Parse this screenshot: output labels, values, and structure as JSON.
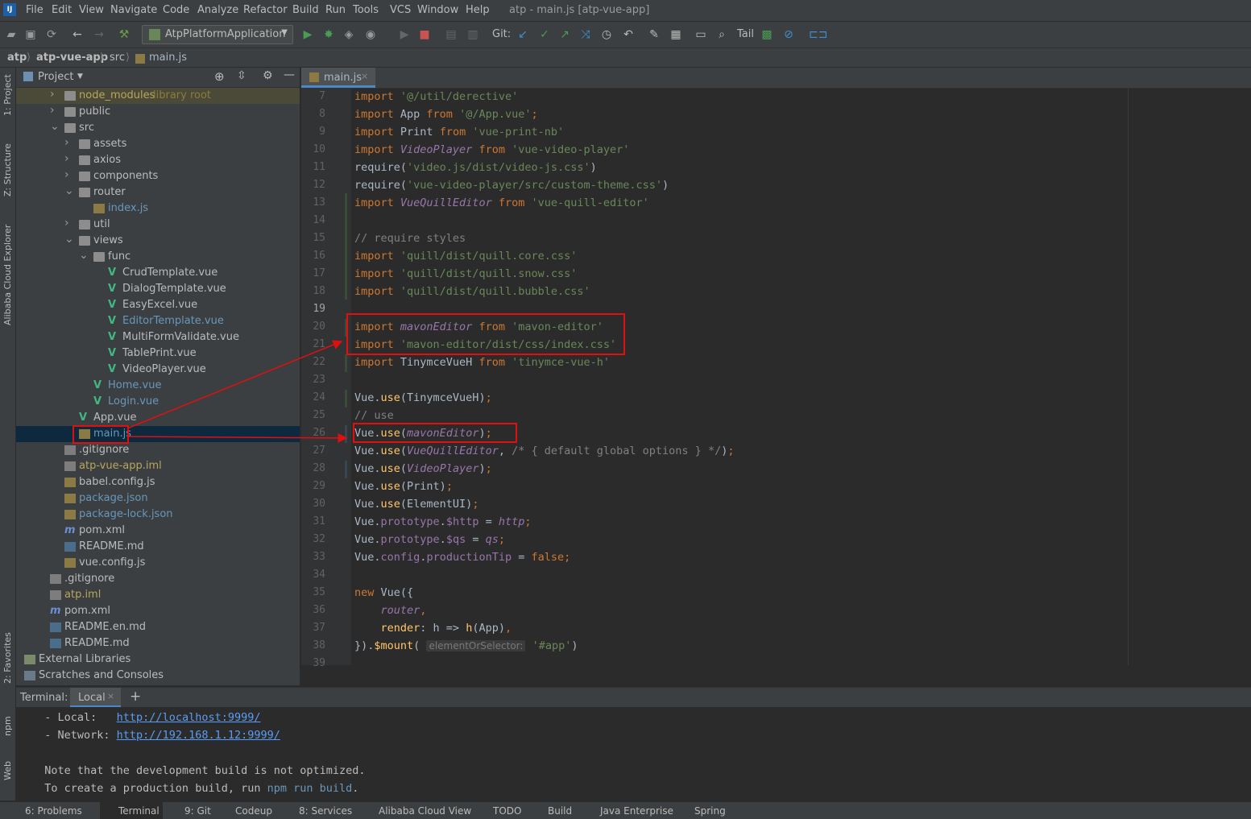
{
  "window_title": "atp - main.js [atp-vue-app]",
  "menu": [
    "File",
    "Edit",
    "View",
    "Navigate",
    "Code",
    "Analyze",
    "Refactor",
    "Build",
    "Run",
    "Tools",
    "VCS",
    "Window",
    "Help"
  ],
  "toolbar": {
    "run_config": "AtpPlatformApplication",
    "git_label": "Git:",
    "tail_label": "Tail"
  },
  "breadcrumb": [
    "atp",
    "atp-vue-app",
    "src",
    "main.js"
  ],
  "left_strip": [
    "1: Project",
    "Z: Structure",
    "Alibaba Cloud Explorer",
    "2: Favorites",
    "npm",
    "Web"
  ],
  "project": {
    "title": "Project",
    "tree": [
      {
        "label": "node_modules",
        "suffix": "library root",
        "icon": "folder",
        "arrow": "right",
        "indent": 1
      },
      {
        "label": "public",
        "icon": "folder",
        "arrow": "right",
        "indent": 1
      },
      {
        "label": "src",
        "icon": "folder",
        "arrow": "down",
        "indent": 1
      },
      {
        "label": "assets",
        "icon": "folder",
        "arrow": "right",
        "indent": 2
      },
      {
        "label": "axios",
        "icon": "folder",
        "arrow": "right",
        "indent": 2
      },
      {
        "label": "components",
        "icon": "folder",
        "arrow": "right",
        "indent": 2
      },
      {
        "label": "router",
        "icon": "folder",
        "arrow": "down",
        "indent": 2
      },
      {
        "label": "index.js",
        "icon": "js",
        "indent": 3
      },
      {
        "label": "util",
        "icon": "folder",
        "arrow": "right",
        "indent": 2
      },
      {
        "label": "views",
        "icon": "folder",
        "arrow": "down",
        "indent": 2
      },
      {
        "label": "func",
        "icon": "folder",
        "arrow": "down",
        "indent": 3
      },
      {
        "label": "CrudTemplate.vue",
        "icon": "vue",
        "indent": 4
      },
      {
        "label": "DialogTemplate.vue",
        "icon": "vue",
        "indent": 4
      },
      {
        "label": "EasyExcel.vue",
        "icon": "vue",
        "indent": 4
      },
      {
        "label": "EditorTemplate.vue",
        "icon": "vue",
        "indent": 4
      },
      {
        "label": "MultiFormValidate.vue",
        "icon": "vue",
        "indent": 4
      },
      {
        "label": "TablePrint.vue",
        "icon": "vue",
        "indent": 4
      },
      {
        "label": "VideoPlayer.vue",
        "icon": "vue",
        "indent": 4
      },
      {
        "label": "Home.vue",
        "icon": "vue",
        "indent": 3
      },
      {
        "label": "Login.vue",
        "icon": "vue",
        "indent": 3
      },
      {
        "label": "App.vue",
        "icon": "vue",
        "indent": 2
      },
      {
        "label": "main.js",
        "icon": "js",
        "indent": 2,
        "selected": true
      },
      {
        "label": ".gitignore",
        "icon": "file",
        "indent": 1
      },
      {
        "label": "atp-vue-app.iml",
        "icon": "file",
        "indent": 1
      },
      {
        "label": "babel.config.js",
        "icon": "js",
        "indent": 1
      },
      {
        "label": "package.json",
        "icon": "js",
        "indent": 1
      },
      {
        "label": "package-lock.json",
        "icon": "js",
        "indent": 1
      },
      {
        "label": "pom.xml",
        "icon": "maven",
        "indent": 1
      },
      {
        "label": "README.md",
        "icon": "md",
        "indent": 1
      },
      {
        "label": "vue.config.js",
        "icon": "js",
        "indent": 1
      },
      {
        "label": ".gitignore",
        "icon": "file",
        "indent": 0
      },
      {
        "label": "atp.iml",
        "icon": "file",
        "indent": 0
      },
      {
        "label": "pom.xml",
        "icon": "maven",
        "indent": 0
      },
      {
        "label": "README.en.md",
        "icon": "md",
        "indent": 0
      },
      {
        "label": "README.md",
        "icon": "md",
        "indent": 0
      },
      {
        "label": "External Libraries",
        "icon": "lib",
        "arrow": "right",
        "indent": -1
      },
      {
        "label": "Scratches and Consoles",
        "icon": "scratch",
        "arrow": "right",
        "indent": -1
      }
    ]
  },
  "editor": {
    "tab": "main.js",
    "first_line": 7,
    "lines": [
      [
        [
          "kw",
          "import "
        ],
        [
          "str",
          "'@/util/derective'"
        ]
      ],
      [
        [
          "kw",
          "import "
        ],
        [
          "t",
          "App "
        ],
        [
          "kw",
          "from "
        ],
        [
          "str",
          "'@/App.vue'"
        ],
        [
          "kw",
          ";"
        ]
      ],
      [
        [
          "kw",
          "import "
        ],
        [
          "t",
          "Print "
        ],
        [
          "kw",
          "from "
        ],
        [
          "str",
          "'vue-print-nb'"
        ]
      ],
      [
        [
          "kw",
          "import "
        ],
        [
          "ital",
          "VideoPlayer "
        ],
        [
          "kw",
          "from "
        ],
        [
          "str",
          "'vue-video-player'"
        ]
      ],
      [
        [
          "t",
          "require("
        ],
        [
          "str",
          "'video.js/dist/video-js.css'"
        ],
        [
          "t",
          ")"
        ]
      ],
      [
        [
          "t",
          "require("
        ],
        [
          "str",
          "'vue-video-player/src/custom-theme.css'"
        ],
        [
          "t",
          ")"
        ]
      ],
      [
        [
          "kw",
          "import "
        ],
        [
          "ital",
          "VueQuillEditor "
        ],
        [
          "kw",
          "from "
        ],
        [
          "str",
          "'vue-quill-editor'"
        ]
      ],
      [],
      [
        [
          "cm",
          "// require styles"
        ]
      ],
      [
        [
          "kw",
          "import "
        ],
        [
          "str",
          "'quill/dist/quill.core.css'"
        ]
      ],
      [
        [
          "kw",
          "import "
        ],
        [
          "str",
          "'quill/dist/quill.snow.css'"
        ]
      ],
      [
        [
          "kw",
          "import "
        ],
        [
          "str",
          "'quill/dist/quill.bubble.css'"
        ]
      ],
      [],
      [
        [
          "kw",
          "import "
        ],
        [
          "ital",
          "mavonEditor "
        ],
        [
          "kw",
          "from "
        ],
        [
          "str",
          "'mavon-editor'"
        ]
      ],
      [
        [
          "kw",
          "import "
        ],
        [
          "str",
          "'mavon-editor/dist/css/index.css'"
        ]
      ],
      [
        [
          "kw",
          "import "
        ],
        [
          "t",
          "TinymceVueH "
        ],
        [
          "kw",
          "from "
        ],
        [
          "str",
          "'tinymce-vue-h'"
        ]
      ],
      [],
      [
        [
          "t",
          "Vue."
        ],
        [
          "fn",
          "use"
        ],
        [
          "t",
          "(TinymceVueH)"
        ],
        [
          "kw",
          ";"
        ]
      ],
      [
        [
          "cm",
          "// use"
        ]
      ],
      [
        [
          "t",
          "Vue."
        ],
        [
          "fn",
          "use"
        ],
        [
          "t",
          "("
        ],
        [
          "ital",
          "mavonEditor"
        ],
        [
          "t",
          ")"
        ],
        [
          "kw",
          ";"
        ]
      ],
      [
        [
          "t",
          "Vue."
        ],
        [
          "fn",
          "use"
        ],
        [
          "t",
          "("
        ],
        [
          "ital",
          "VueQuillEditor"
        ],
        [
          "t",
          ", "
        ],
        [
          "cm",
          "/* { default global options } */"
        ],
        [
          "t",
          ")"
        ],
        [
          "kw",
          ";"
        ]
      ],
      [
        [
          "t",
          "Vue."
        ],
        [
          "fn",
          "use"
        ],
        [
          "t",
          "("
        ],
        [
          "ital",
          "VideoPlayer"
        ],
        [
          "t",
          ")"
        ],
        [
          "kw",
          ";"
        ]
      ],
      [
        [
          "t",
          "Vue."
        ],
        [
          "fn",
          "use"
        ],
        [
          "t",
          "(Print)"
        ],
        [
          "kw",
          ";"
        ]
      ],
      [
        [
          "t",
          "Vue."
        ],
        [
          "fn",
          "use"
        ],
        [
          "t",
          "(ElementUI)"
        ],
        [
          "kw",
          ";"
        ]
      ],
      [
        [
          "t",
          "Vue."
        ],
        [
          "prop",
          "prototype"
        ],
        [
          "t",
          "."
        ],
        [
          "prop",
          "$http"
        ],
        [
          "t",
          " = "
        ],
        [
          "ital",
          "http"
        ],
        [
          "kw",
          ";"
        ]
      ],
      [
        [
          "t",
          "Vue."
        ],
        [
          "prop",
          "prototype"
        ],
        [
          "t",
          "."
        ],
        [
          "prop",
          "$qs"
        ],
        [
          "t",
          " = "
        ],
        [
          "ital",
          "qs"
        ],
        [
          "kw",
          ";"
        ]
      ],
      [
        [
          "t",
          "Vue."
        ],
        [
          "prop",
          "config"
        ],
        [
          "t",
          "."
        ],
        [
          "prop",
          "productionTip"
        ],
        [
          "t",
          " = "
        ],
        [
          "kw",
          "false;"
        ]
      ],
      [],
      [
        [
          "kw",
          "new "
        ],
        [
          "t",
          "Vue({"
        ]
      ],
      [
        [
          "t",
          "    "
        ],
        [
          "ital",
          "router"
        ],
        [
          "kw",
          ","
        ]
      ],
      [
        [
          "t",
          "    "
        ],
        [
          "fn",
          "render"
        ],
        [
          "t",
          ": h => "
        ],
        [
          "fn",
          "h"
        ],
        [
          "t",
          "(App)"
        ],
        [
          "kw",
          ","
        ]
      ],
      [
        [
          "t",
          "})."
        ],
        [
          "fn",
          "$mount"
        ],
        [
          "t",
          "( "
        ],
        [
          "hint",
          "elementOrSelector:"
        ],
        [
          "t",
          " "
        ],
        [
          "str",
          "'#app'"
        ],
        [
          "t",
          ")"
        ]
      ],
      []
    ]
  },
  "terminal": {
    "label": "Terminal:",
    "tab": "Local",
    "local_label": "  - Local:   ",
    "local_url": "http://localhost:9999/",
    "network_label": "  - Network: ",
    "network_url": "http://192.168.1.12:9999/",
    "note": "  Note that the development build is not optimized.",
    "create_prefix": "  To create a production build, run ",
    "create_cmd": "npm run build",
    "create_suffix": "."
  },
  "statusbar": [
    "6: Problems",
    "Terminal",
    "9: Git",
    "Codeup",
    "8: Services",
    "Alibaba Cloud View",
    "TODO",
    "Build",
    "Java Enterprise",
    "Spring"
  ],
  "colors": {
    "annotation": "#e01010",
    "selection": "#0d293e",
    "accent": "#4a88c7"
  }
}
